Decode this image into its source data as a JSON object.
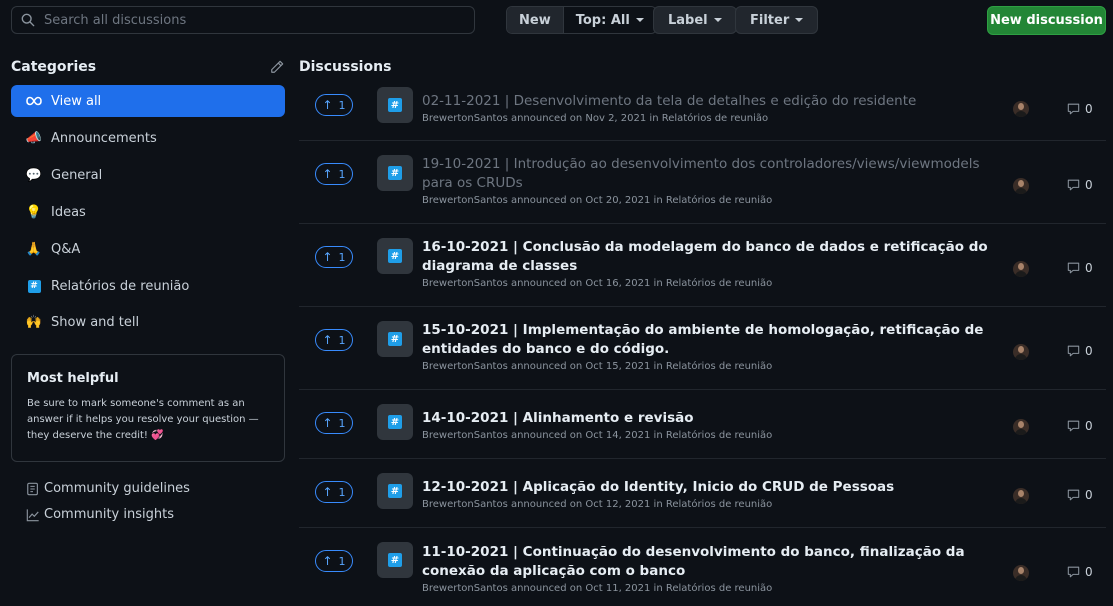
{
  "search": {
    "placeholder": "Search all discussions"
  },
  "sort": {
    "new_label": "New",
    "top_label": "Top: All"
  },
  "filters": {
    "label_label": "Label",
    "filter_label": "Filter"
  },
  "new_discussion_label": "New discussion",
  "sidebar": {
    "title": "Categories",
    "categories": [
      {
        "label": "View all",
        "icon": "infinity-icon",
        "emoji": "∞"
      },
      {
        "label": "Announcements",
        "icon": "loudspeaker-icon",
        "emoji": "📣"
      },
      {
        "label": "General",
        "icon": "speech-balloon-icon",
        "emoji": "💬"
      },
      {
        "label": "Ideas",
        "icon": "light-bulb-icon",
        "emoji": "💡"
      },
      {
        "label": "Q&A",
        "icon": "pray-icon",
        "emoji": "🙏"
      },
      {
        "label": "Relatórios de reunião",
        "icon": "hash-icon",
        "emoji": "#"
      },
      {
        "label": "Show and tell",
        "icon": "raised-hands-icon",
        "emoji": "🙌"
      }
    ],
    "most_helpful": {
      "title": "Most helpful",
      "text": "Be sure to mark someone's comment as an answer if it helps you resolve your question — they deserve the credit! 💞"
    },
    "links": [
      {
        "label": "Community guidelines",
        "icon": "guidelines-icon"
      },
      {
        "label": "Community insights",
        "icon": "graph-icon"
      }
    ]
  },
  "main": {
    "title": "Discussions",
    "discussions": [
      {
        "votes": "1",
        "title": "02-11-2021 | Desenvolvimento da tela de detalhes e edição do residente",
        "meta": "BrewertonSantos announced on Nov 2, 2021 in Relatórios de reunião",
        "comments": "0",
        "read": true
      },
      {
        "votes": "1",
        "title": "19-10-2021 | Introdução ao desenvolvimento dos controladores/views/viewmodels para os CRUDs",
        "meta": "BrewertonSantos announced on Oct 20, 2021 in Relatórios de reunião",
        "comments": "0",
        "read": true
      },
      {
        "votes": "1",
        "title": "16-10-2021 | Conclusão da modelagem do banco de dados e retificação do diagrama de classes",
        "meta": "BrewertonSantos announced on Oct 16, 2021 in Relatórios de reunião",
        "comments": "0",
        "read": false
      },
      {
        "votes": "1",
        "title": "15-10-2021 | Implementação do ambiente de homologação, retificação de entidades do banco e do código.",
        "meta": "BrewertonSantos announced on Oct 15, 2021 in Relatórios de reunião",
        "comments": "0",
        "read": false
      },
      {
        "votes": "1",
        "title": "14-10-2021 | Alinhamento e revisão",
        "meta": "BrewertonSantos announced on Oct 14, 2021 in Relatórios de reunião",
        "comments": "0",
        "read": false
      },
      {
        "votes": "1",
        "title": "12-10-2021 | Aplicação do Identity, Inicio do CRUD de Pessoas",
        "meta": "BrewertonSantos announced on Oct 12, 2021 in Relatórios de reunião",
        "comments": "0",
        "read": false
      },
      {
        "votes": "1",
        "title": "11-10-2021 | Continuação do desenvolvimento do banco, finalização da conexão da aplicação com o banco",
        "meta": "BrewertonSantos announced on Oct 11, 2021 in Relatórios de reunião",
        "comments": "0",
        "read": false
      }
    ]
  },
  "colors": {
    "accent": "#1f6feb",
    "primary_button": "#238636",
    "vote_border": "#388bfd",
    "background": "#0d1117"
  }
}
